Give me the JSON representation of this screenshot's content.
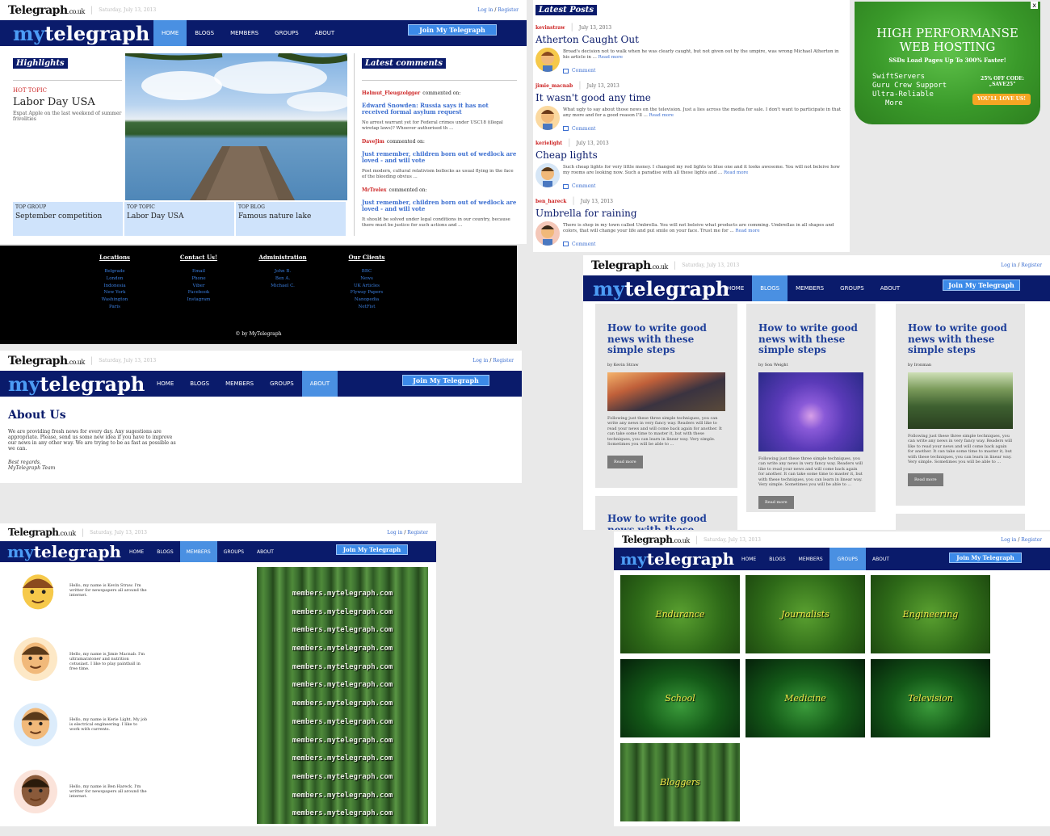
{
  "common": {
    "logo": "Telegraph",
    "logo_suffix": ".co.uk",
    "date": "Saturday, July 13, 2013",
    "login": "Log in",
    "login_sep": " / ",
    "register": "Register",
    "brand_my": "my",
    "brand_rest": "telegraph",
    "nav": [
      "HOME",
      "BLOGS",
      "MEMBERS",
      "GROUPS",
      "ABOUT"
    ],
    "join": "Join My Telegraph"
  },
  "home": {
    "highlights": "Highlights",
    "hot_topic_label": "HOT TOPIC",
    "hot_topic_title": "Labor Day USA",
    "hot_topic_desc": "Expat Apple on the last weekend of summer frivolities",
    "cards": [
      {
        "label": "TOP GROUP",
        "title": "September competition"
      },
      {
        "label": "TOP TOPIC",
        "title": "Labor Day USA"
      },
      {
        "label": "TOP BLOG",
        "title": "Famous nature lake"
      }
    ],
    "latest_comments_title": "Latest comments",
    "comments": [
      {
        "user": "Helmut_Fleugzolgger",
        "verb": "commented on:",
        "title": "Edward Snowden: Russia says it has not received formal asylum request",
        "text": "No arrest warrant yet for Federal crimes under USC18 (illegal wiretap laws)? Whoever authorised th ..."
      },
      {
        "user": "DaveJim",
        "verb": "commented on:",
        "title": "Just remember, children born out of wedlock are loved - and will vote",
        "text": "Post modern, cultural relativism bollocks as usual flying in the face of the bleeding obvius ..."
      },
      {
        "user": "MrTrelex",
        "verb": "commented on:",
        "title": "Just remember, children born out of wedlock are loved - and will vote",
        "text": "It should be solved under legal conditions in our country, because there must be justice for such actions and ..."
      }
    ]
  },
  "footer": {
    "columns": [
      {
        "title": "Locations",
        "items": [
          "Belgrade",
          "London",
          "Indonesia",
          "New York",
          "Washington",
          "Paris"
        ]
      },
      {
        "title": "Contact Us!",
        "items": [
          "Email",
          "Phone",
          "Viber",
          "Facebook",
          "Instagram"
        ]
      },
      {
        "title": "Administration",
        "items": [
          "John B.",
          "Ben A.",
          "Michael C."
        ]
      },
      {
        "title": "Our Clients",
        "items": [
          "BBC",
          "News",
          "UK Articles",
          "Flyway Papers",
          "Nanopedia",
          "NetFist"
        ]
      }
    ],
    "copyright": "© by MyTelegraph"
  },
  "latest_posts": {
    "title": "Latest Posts",
    "comment_label": "Comment",
    "read_more": "Read more",
    "posts": [
      {
        "user": "kevinstraw",
        "date": "July 13, 2013",
        "title": "Atherton Caught Out",
        "text": "Broad's decision not to walk when he was clearly caught, but not given out by the umpire, was wrong Michael Atherton in his article in ..."
      },
      {
        "user": "jimie_macnab",
        "date": "July 13, 2013",
        "title": "It wasn't good any time",
        "text": "What ugly to say about those news on the television. Just a lies across the media for sale. I don't want to participate in that any more and for a good reason I'll ..."
      },
      {
        "user": "kerielight",
        "date": "July 13, 2013",
        "title": "Cheap lights",
        "text": "Such cheap lights for very little money. I changed my red lights to blue one and it looks awesome. You will not beleive how my rooms are looking now. Such a paradise with all these lights and ..."
      },
      {
        "user": "ben_hareck",
        "date": "July 13, 2013",
        "title": "Umbrella for raining",
        "text": "There is shop in my town called Umbrella. You will not beleive what products are comming. Umbrellas in all shapes and colors, that will change your life and put smile on your face. Trust me for ..."
      }
    ]
  },
  "ad": {
    "close": "x",
    "title1": "HIGH PERFORMANSE",
    "title2": "WEB HOSTING",
    "tagline": "SSDs Load Pages Up To 300% Faster!",
    "features": [
      "SwiftServers",
      "Guru Crew Support",
      "Ultra-Reliable",
      "More"
    ],
    "discount1": "25% OFF CODE:",
    "discount2": "„SAVE25\"",
    "cta": "YOU'LL LOVE US!"
  },
  "about": {
    "heading": "About Us",
    "text": "We are providing fresh news for every day. Any sugestions are appropriate. Please, send us some new idea if you have to improve our news in any other way. We are trying to be as fast as possible as we can.",
    "regards": "Best regards,",
    "team": "MyTelegraph Team"
  },
  "blogs": {
    "read_more": "Read more",
    "posts": [
      {
        "title": "How to write good news with these simple steps",
        "by": "by Kevin Straw",
        "text": "Following just these three simple techniques, you can write any news in very fancy way. Readers will like to read your news and will come back again for another. It can take some time to master it, but with these techniques, you can learn in linear way. Very simple. Sometimes you will be able to ..."
      },
      {
        "title": "How to write good news with these simple steps",
        "by": "by Son Weight",
        "text": "Following just these three simple techniques, you can write any news in very fancy way. Readers will like to read your news and will come back again for another. It can take some time to master it, but with these techniques, you can learn in linear way. Very simple. Sometimes you will be able to ..."
      },
      {
        "title": "How to write good news with these simple steps",
        "by": "by Ironman",
        "text": "Following just these three simple techniques, you can write any news in very fancy way. Readers will like to read your news and will come back again for another. It can take some time to master it, but with these techniques, you can learn in linear way. Very simple. Sometimes you will be able to ..."
      }
    ],
    "partial_title": "How to write good news with these simple"
  },
  "members": {
    "list": [
      {
        "text": "Hello, my name is Kevin Straw. I'm writter for newspapers all around the internet."
      },
      {
        "text": "Hello, my name is Jimie Macnab. I'm ultramaratoner and nutrition cotusiast. I like to play paintball in free time."
      },
      {
        "text": "Hello, my name is Kerie Light. My job is electrical engineering. I like to work with currents."
      },
      {
        "text": "Hello, my name is Ben Hareck. I'm writter for newspapers all around the internet."
      }
    ],
    "banner_text": "members.mytelegraph.com"
  },
  "groups": {
    "items": [
      "Endurance",
      "Journalists",
      "Engineering",
      "School",
      "Medicine",
      "Television",
      "Bloggers"
    ]
  },
  "colors": {
    "navy": "#0a1b6b",
    "nav_active": "#4a90e2",
    "link": "#3b6ed0",
    "red": "#c22",
    "ad_green": "#3a9a2a",
    "ad_orange": "#f5a623"
  }
}
